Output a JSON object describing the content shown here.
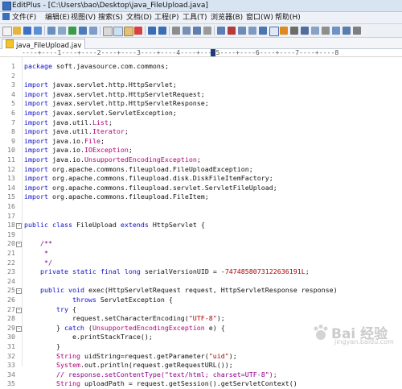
{
  "window": {
    "title": "EditPlus - [C:\\Users\\bao\\Desktop\\java_FileUpload.java]"
  },
  "menu": [
    "文件(F)",
    "编辑(E)",
    "视图(V)",
    "搜索(S)",
    "文档(D)",
    "工程(P)",
    "工具(T)",
    "浏览器(B)",
    "窗口(W)",
    "帮助(H)"
  ],
  "tab": {
    "label": "java_FileUpload.jav"
  },
  "ruler": "----+----1----+----2----+----3----+----4----+----5----+----6----+----7----+----8",
  "code_lines": [
    {
      "n": "1",
      "t": "package soft.javasource.com.commons;"
    },
    {
      "n": "2",
      "t": ""
    },
    {
      "n": "3",
      "t": "import javax.servlet.http.HttpServlet;"
    },
    {
      "n": "4",
      "t": "import javax.servlet.http.HttpServletRequest;"
    },
    {
      "n": "5",
      "t": "import javax.servlet.http.HttpServletResponse;"
    },
    {
      "n": "6",
      "t": "import javax.servlet.ServletException;"
    },
    {
      "n": "7",
      "t": "import java.util.List;"
    },
    {
      "n": "8",
      "t": "import java.util.Iterator;"
    },
    {
      "n": "9",
      "t": "import java.io.File;"
    },
    {
      "n": "10",
      "t": "import java.io.IOException;"
    },
    {
      "n": "11",
      "t": "import java.io.UnsupportedEncodingException;"
    },
    {
      "n": "12",
      "t": "import org.apache.commons.fileupload.FileUploadException;"
    },
    {
      "n": "13",
      "t": "import org.apache.commons.fileupload.disk.DiskFileItemFactory;"
    },
    {
      "n": "14",
      "t": "import org.apache.commons.fileupload.servlet.ServletFileUpload;"
    },
    {
      "n": "15",
      "t": "import org.apache.commons.fileupload.FileItem;"
    },
    {
      "n": "16",
      "t": ""
    },
    {
      "n": "17",
      "t": ""
    },
    {
      "n": "18",
      "t": "public class FileUpload extends HttpServlet {"
    },
    {
      "n": "19",
      "t": ""
    },
    {
      "n": "20",
      "t": "    /**"
    },
    {
      "n": "21",
      "t": "     *"
    },
    {
      "n": "22",
      "t": "     */"
    },
    {
      "n": "23",
      "t": "    private static final long serialVersionUID = -7474858073122636191L;"
    },
    {
      "n": "24",
      "t": ""
    },
    {
      "n": "25",
      "t": "    public void exec(HttpServletRequest request, HttpServletResponse response)"
    },
    {
      "n": "26",
      "t": "            throws ServletException {"
    },
    {
      "n": "27",
      "t": "        try {"
    },
    {
      "n": "28",
      "t": "            request.setCharacterEncoding(\"UTF-8\");"
    },
    {
      "n": "29",
      "t": "        } catch (UnsupportedEncodingException e) {"
    },
    {
      "n": "30",
      "t": "            e.printStackTrace();"
    },
    {
      "n": "31",
      "t": "        }"
    },
    {
      "n": "32",
      "t": "        String uidString=request.getParameter(\"uid\");"
    },
    {
      "n": "33",
      "t": "        System.out.println(request.getRequestURL());"
    },
    {
      "n": "34",
      "t": "        // response.setContentType(\"text/html; charset=UTF-8\");"
    },
    {
      "n": "35",
      "t": "        String uploadPath = request.getSession().getServletContext()"
    }
  ],
  "watermark": {
    "text": "Bai 经验",
    "sub": "jingyan.baidu.com"
  }
}
